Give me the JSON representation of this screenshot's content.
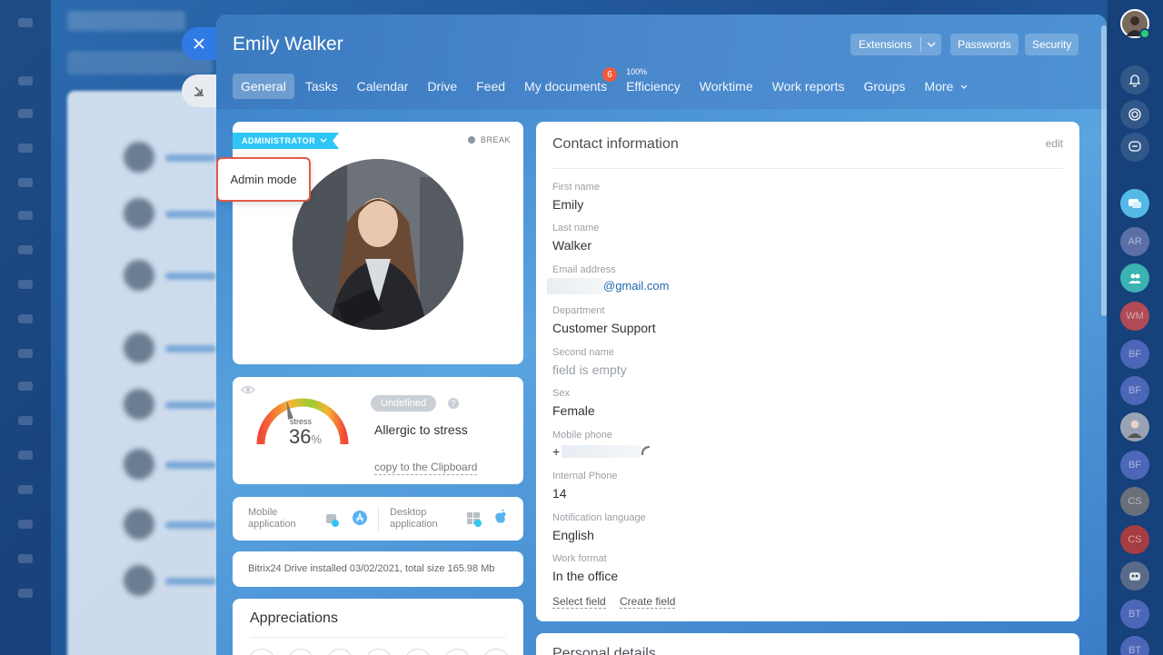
{
  "background": {
    "title_blur": "Find Employee"
  },
  "header": {
    "title": "Emily Walker",
    "buttons": {
      "extensions": "Extensions",
      "passwords": "Passwords",
      "security": "Security"
    }
  },
  "tabs": [
    {
      "label": "General",
      "active": true
    },
    {
      "label": "Tasks"
    },
    {
      "label": "Calendar"
    },
    {
      "label": "Drive"
    },
    {
      "label": "Feed"
    },
    {
      "label": "My documents",
      "badge": "6"
    },
    {
      "label": "Efficiency",
      "top_label": "100%"
    },
    {
      "label": "Worktime"
    },
    {
      "label": "Work reports"
    },
    {
      "label": "Groups"
    },
    {
      "label": "More"
    }
  ],
  "profile": {
    "role_label": "ADMINISTRATOR",
    "status_label": "BREAK",
    "admin_tooltip": "Admin mode"
  },
  "stress": {
    "gauge_label": "stress",
    "value": "36",
    "unit": "%",
    "level": 0.36,
    "badge": "Undefined",
    "help": "?",
    "description": "Allergic to stress",
    "copy_link": "copy to the Clipboard"
  },
  "apps": {
    "mobile_label": "Mobile application",
    "desktop_label": "Desktop application"
  },
  "drive_info": "Bitrix24 Drive installed 03/02/2021, total size 165.98 Mb",
  "appreciations_title": "Appreciations",
  "contact": {
    "title": "Contact information",
    "edit": "edit",
    "fields": [
      {
        "label": "First name",
        "value": "Emily"
      },
      {
        "label": "Last name",
        "value": "Walker"
      },
      {
        "label": "Email address",
        "value": "@gmail.com"
      },
      {
        "label": "Department",
        "value": "Customer Support"
      },
      {
        "label": "Second name",
        "value": "field is empty"
      },
      {
        "label": "Sex",
        "value": "Female"
      },
      {
        "label": "Mobile phone",
        "value": "+"
      },
      {
        "label": "Internal Phone",
        "value": "14"
      },
      {
        "label": "Notification language",
        "value": "English"
      },
      {
        "label": "Work format",
        "value": "In the office"
      }
    ],
    "select_field": "Select field",
    "create_field": "Create field"
  },
  "personal_details_title": "Personal details",
  "right_rail": {
    "avatars": [
      "AR",
      "WM",
      "BF",
      "BF",
      "BF",
      "CS",
      "CS",
      "BT",
      "BT"
    ]
  },
  "colors": {
    "accent_blue": "#2f7ae5",
    "ribbon": "#2fc6f6",
    "badge_red": "#f05a3a",
    "tooltip_border": "#e35a4a"
  }
}
